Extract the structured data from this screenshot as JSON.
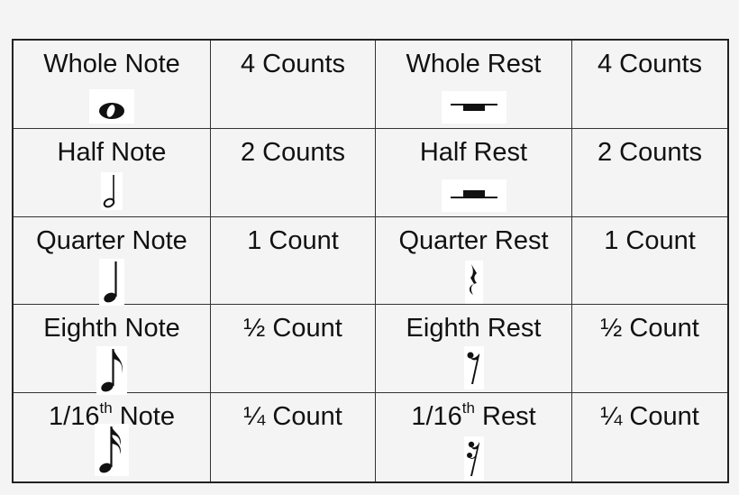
{
  "rows": [
    {
      "note": {
        "pre": "Whole Note",
        "sup": "",
        "post": ""
      },
      "note_count": "4 Counts",
      "note_icon": "whole-note-icon",
      "rest": {
        "pre": "Whole Rest",
        "sup": "",
        "post": ""
      },
      "rest_count": "4 Counts",
      "rest_icon": "whole-rest-icon"
    },
    {
      "note": {
        "pre": "Half Note",
        "sup": "",
        "post": ""
      },
      "note_count": "2 Counts",
      "note_icon": "half-note-icon",
      "rest": {
        "pre": "Half Rest",
        "sup": "",
        "post": ""
      },
      "rest_count": "2 Counts",
      "rest_icon": "half-rest-icon"
    },
    {
      "note": {
        "pre": "Quarter Note",
        "sup": "",
        "post": ""
      },
      "note_count": "1 Count",
      "note_icon": "quarter-note-icon",
      "rest": {
        "pre": "Quarter Rest",
        "sup": "",
        "post": ""
      },
      "rest_count": "1 Count",
      "rest_icon": "quarter-rest-icon"
    },
    {
      "note": {
        "pre": "Eighth Note",
        "sup": "",
        "post": ""
      },
      "note_count": "½ Count",
      "note_icon": "eighth-note-icon",
      "rest": {
        "pre": "Eighth Rest",
        "sup": "",
        "post": ""
      },
      "rest_count": "½ Count",
      "rest_icon": "eighth-rest-icon"
    },
    {
      "note": {
        "pre": "1/16",
        "sup": "th",
        "post": " Note"
      },
      "note_count": "¼ Count",
      "note_icon": "sixteenth-note-icon",
      "rest": {
        "pre": "1/16",
        "sup": "th",
        "post": " Rest"
      },
      "rest_count": "¼ Count",
      "rest_icon": "sixteenth-rest-icon"
    }
  ]
}
